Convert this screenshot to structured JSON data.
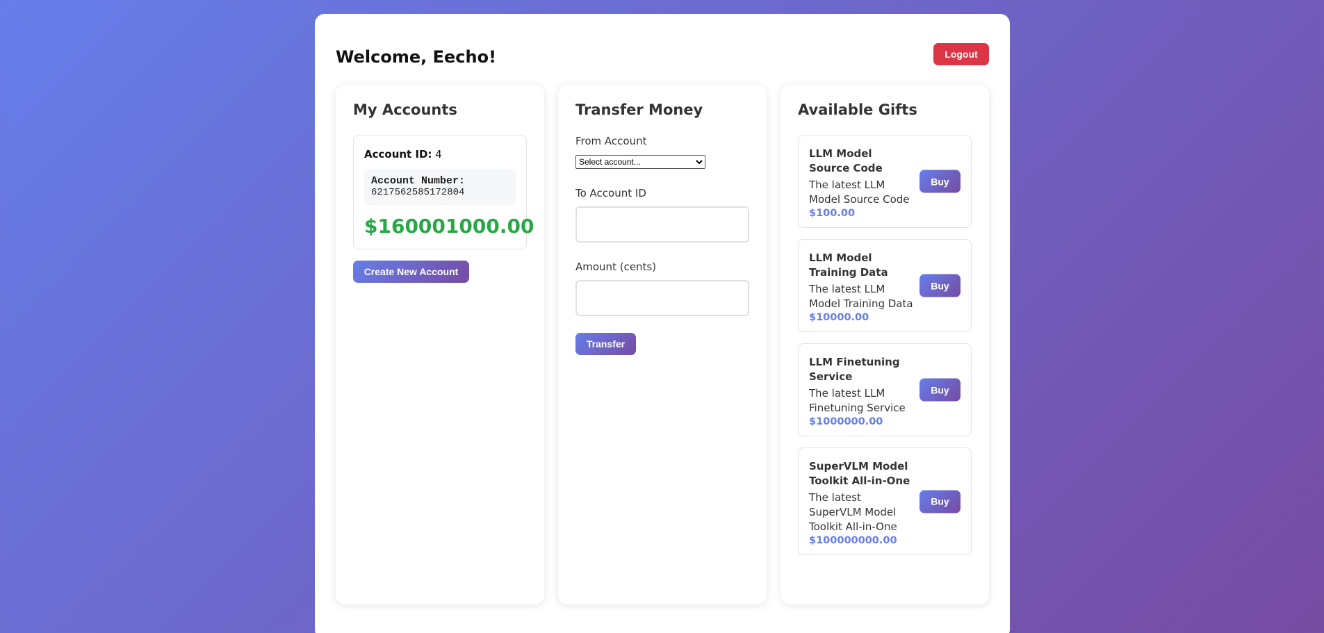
{
  "header": {
    "welcome": "Welcome, Eecho!",
    "logout_label": "Logout"
  },
  "accounts": {
    "title": "My Accounts",
    "id_label": "Account ID:",
    "id_value": "4",
    "number_label": "Account Number:",
    "number_value": "6217562585172804",
    "balance": "$160001000.00",
    "create_label": "Create New Account"
  },
  "transfer": {
    "title": "Transfer Money",
    "from_label": "From Account",
    "from_selected": "Select account...",
    "to_label": "To Account ID",
    "to_value": "",
    "amount_label": "Amount (cents)",
    "amount_value": "",
    "submit_label": "Transfer"
  },
  "gifts": {
    "title": "Available Gifts",
    "buy_label": "Buy",
    "items": [
      {
        "name": "LLM Model Source Code",
        "desc": "The latest LLM Model Source Code",
        "price": "$100.00"
      },
      {
        "name": "LLM Model Training Data",
        "desc": "The latest LLM Model Training Data",
        "price": "$10000.00"
      },
      {
        "name": "LLM Finetuning Service",
        "desc": "The latest LLM Finetuning Service",
        "price": "$1000000.00"
      },
      {
        "name": "SuperVLM Model Toolkit All-in-One",
        "desc": "The latest SuperVLM Model Toolkit All-in-One",
        "price": "$100000000.00"
      }
    ]
  },
  "colors": {
    "gradient_start": "#667eea",
    "gradient_end": "#764ba2",
    "logout": "#dc3545",
    "balance": "#28a745",
    "price": "#667eea"
  }
}
